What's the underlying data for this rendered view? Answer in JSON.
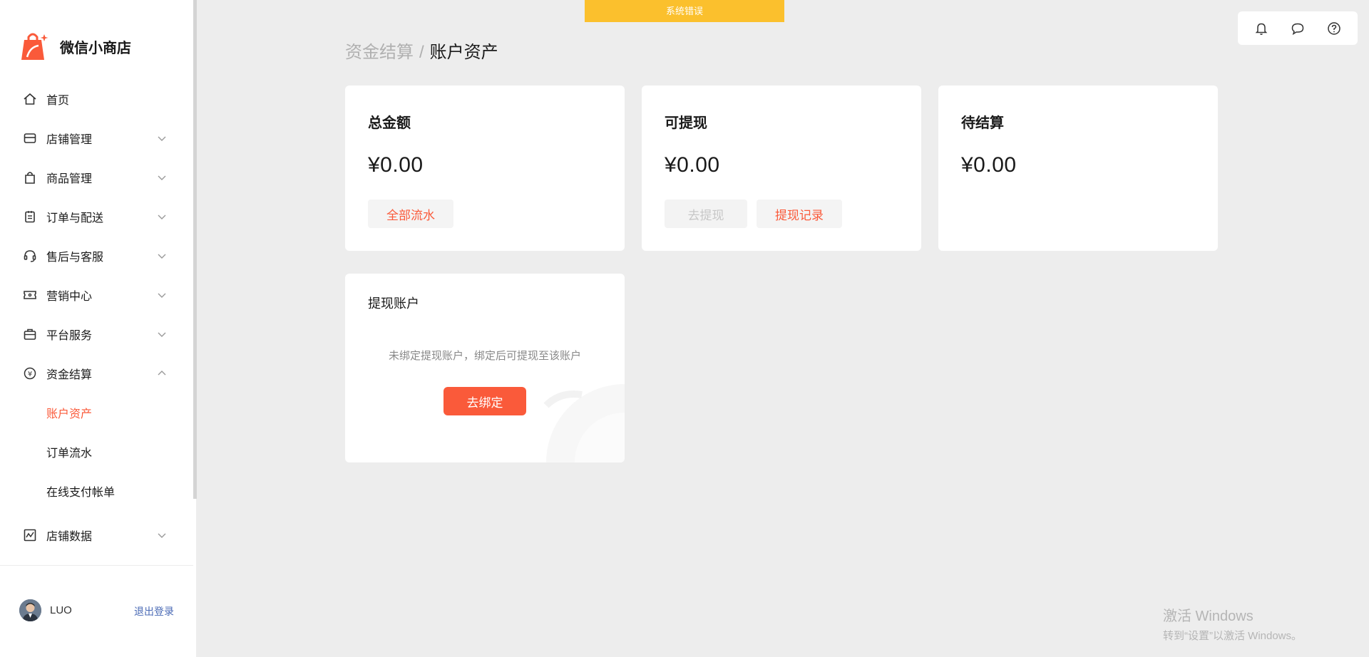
{
  "app": {
    "name": "微信小商店",
    "brand_color": "#fa5a3a"
  },
  "system_error": "系统错误",
  "sidebar": {
    "items": [
      {
        "label": "首页",
        "icon": "home-icon",
        "expandable": false
      },
      {
        "label": "店铺管理",
        "icon": "store-icon",
        "expandable": true
      },
      {
        "label": "商品管理",
        "icon": "shopping-bag-icon",
        "expandable": true
      },
      {
        "label": "订单与配送",
        "icon": "clipboard-icon",
        "expandable": true
      },
      {
        "label": "售后与客服",
        "icon": "headset-icon",
        "expandable": true
      },
      {
        "label": "营销中心",
        "icon": "ticket-icon",
        "expandable": true
      },
      {
        "label": "平台服务",
        "icon": "briefcase-icon",
        "expandable": true
      },
      {
        "label": "资金结算",
        "icon": "yen-circle-icon",
        "expandable": true,
        "expanded": true
      },
      {
        "label": "店铺数据",
        "icon": "chart-icon",
        "expandable": true
      }
    ],
    "sub_items": [
      {
        "label": "账户资产",
        "active": true
      },
      {
        "label": "订单流水",
        "active": false
      },
      {
        "label": "在线支付帐单",
        "active": false
      }
    ]
  },
  "user": {
    "name": "LUO",
    "logout_label": "退出登录"
  },
  "toolbar": {
    "icons": [
      "bell-icon",
      "chat-icon",
      "help-icon"
    ]
  },
  "breadcrumb": {
    "parent": "资金结算",
    "separator": "/",
    "current": "账户资产"
  },
  "cards": {
    "total": {
      "title": "总金额",
      "amount": "¥0.00",
      "button": "全部流水"
    },
    "withdrawable": {
      "title": "可提现",
      "amount": "¥0.00",
      "button_disabled": "去提现",
      "button": "提现记录"
    },
    "pending": {
      "title": "待结算",
      "amount": "¥0.00"
    }
  },
  "account": {
    "title": "提现账户",
    "hint": "未绑定提现账户，绑定后可提现至该账户",
    "bind_label": "去绑定"
  },
  "watermark": {
    "title": "激活 Windows",
    "subtitle": "转到“设置”以激活 Windows。"
  }
}
